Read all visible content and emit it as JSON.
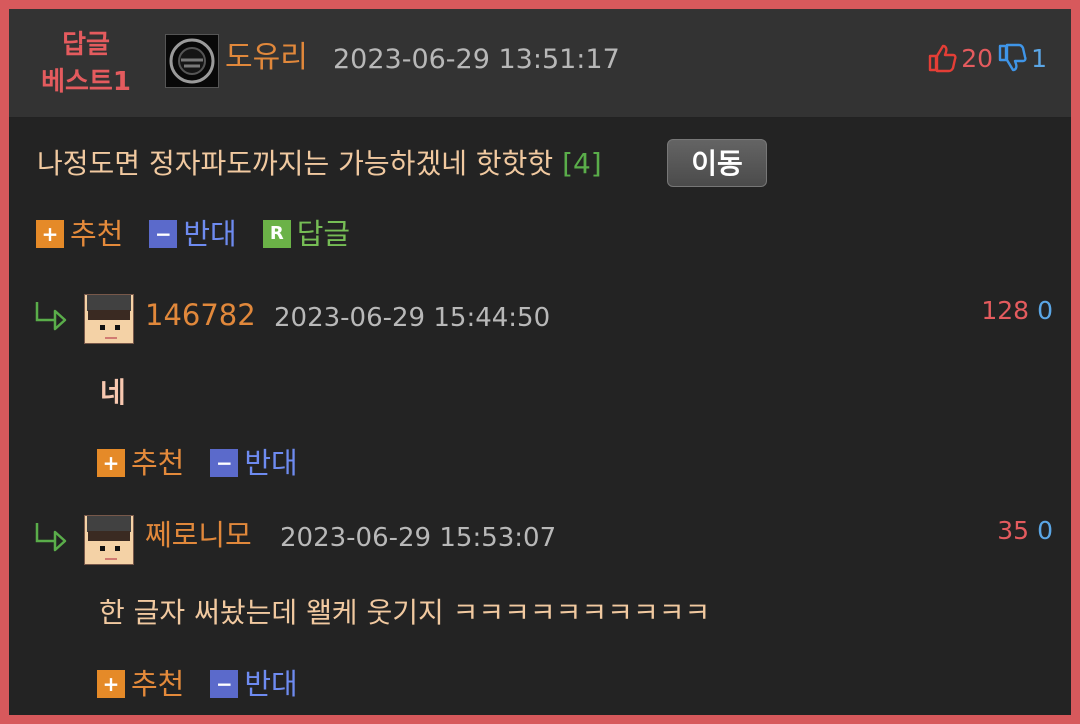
{
  "post": {
    "best_label_line1": "답글",
    "best_label_line2": "베스트1",
    "author": "도유리",
    "timestamp": "2023-06-29 13:51:17",
    "upvotes": "20",
    "downvotes": "1",
    "text": "나정도면 정자파도까지는 가능하겠네 핫핫핫",
    "reply_count": "[4]",
    "move_button": "이동"
  },
  "actions": {
    "recommend": "추천",
    "oppose": "반대",
    "reply": "답글",
    "plus_icon": "+",
    "minus_icon": "−",
    "reply_icon": "R"
  },
  "replies": [
    {
      "author": "146782",
      "timestamp": "2023-06-29 15:44:50",
      "upvotes": "128",
      "downvotes": "0",
      "text": "네"
    },
    {
      "author": "쩨로니모",
      "timestamp": "2023-06-29 15:53:07",
      "upvotes": "35",
      "downvotes": "0",
      "text": "한 글자 써놨는데 왤케 웃기지 ㅋㅋㅋㅋㅋㅋㅋㅋㅋㅋ"
    }
  ],
  "colors": {
    "frame": "#d7595c",
    "background": "#232323",
    "header": "#333333",
    "accent_orange": "#e1883b",
    "up_red": "#e45b5e",
    "down_blue": "#5ba6e5"
  },
  "icons": {
    "avatar_main": "dark-round-avatar-icon",
    "thumb_up": "thumb-up-icon",
    "thumb_down": "thumb-down-icon",
    "reply_arrow": "reply-arrow-icon",
    "pixel_avatar": "pixel-avatar-icon"
  }
}
